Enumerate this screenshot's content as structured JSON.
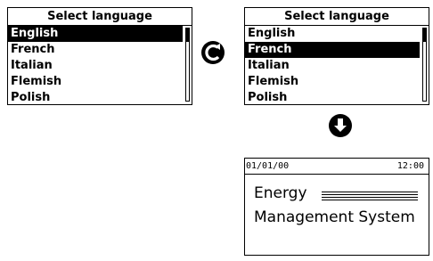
{
  "left_screen": {
    "title": "Select language",
    "items": [
      "English",
      "French",
      "Italian",
      "Flemish",
      "Polish"
    ],
    "selected_label": "English"
  },
  "right_screen": {
    "title": "Select language",
    "items": [
      "English",
      "French",
      "Italian",
      "Flemish",
      "Polish"
    ],
    "selected_label": "French"
  },
  "icons": {
    "rotate": "rotate-icon",
    "down": "arrow-down-icon"
  },
  "home_screen": {
    "date": "01/01/00",
    "time": "12:00",
    "line1": "Energy",
    "line2": "Management System"
  }
}
